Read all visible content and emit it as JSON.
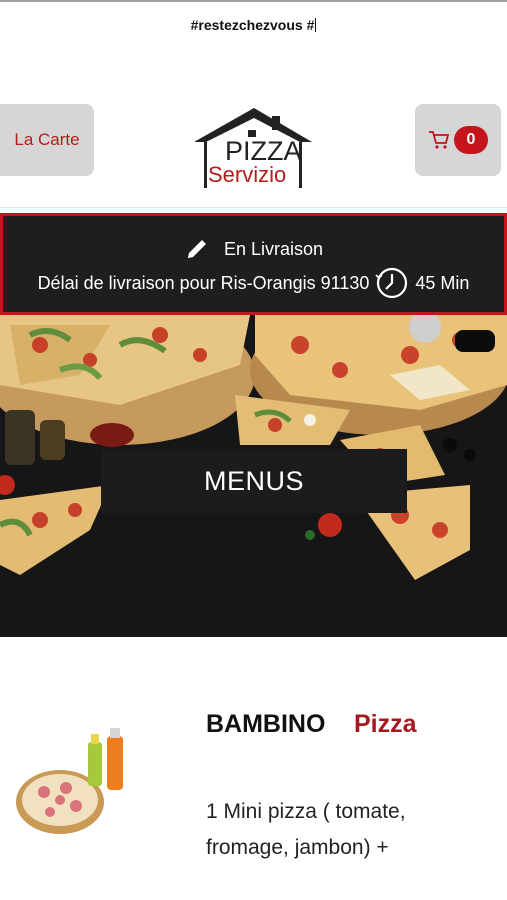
{
  "banner": {
    "hashtag": "#restezchezvous #"
  },
  "header": {
    "left_button_label": "La Carte",
    "cart_count": "0",
    "logo_line1": "PIZZA",
    "logo_line2": "Servizio",
    "cart_icon": "cart-icon"
  },
  "delivery": {
    "mode_label": "En Livraison",
    "delay_text": "Délai de livraison pour Ris-Orangis 91130",
    "duration": "45 Min",
    "edit_icon": "pencil-icon",
    "clock_icon": "clock-icon"
  },
  "hero": {
    "button_label": "MENUS"
  },
  "product": {
    "title": "BAMBINO",
    "category": "Pizza",
    "description": "1 Mini pizza ( tomate, fromage, jambon) +"
  },
  "colors": {
    "brand_red": "#c4141c",
    "dark_bar": "#1e1e1e",
    "button_grey": "#d6d6d6"
  }
}
